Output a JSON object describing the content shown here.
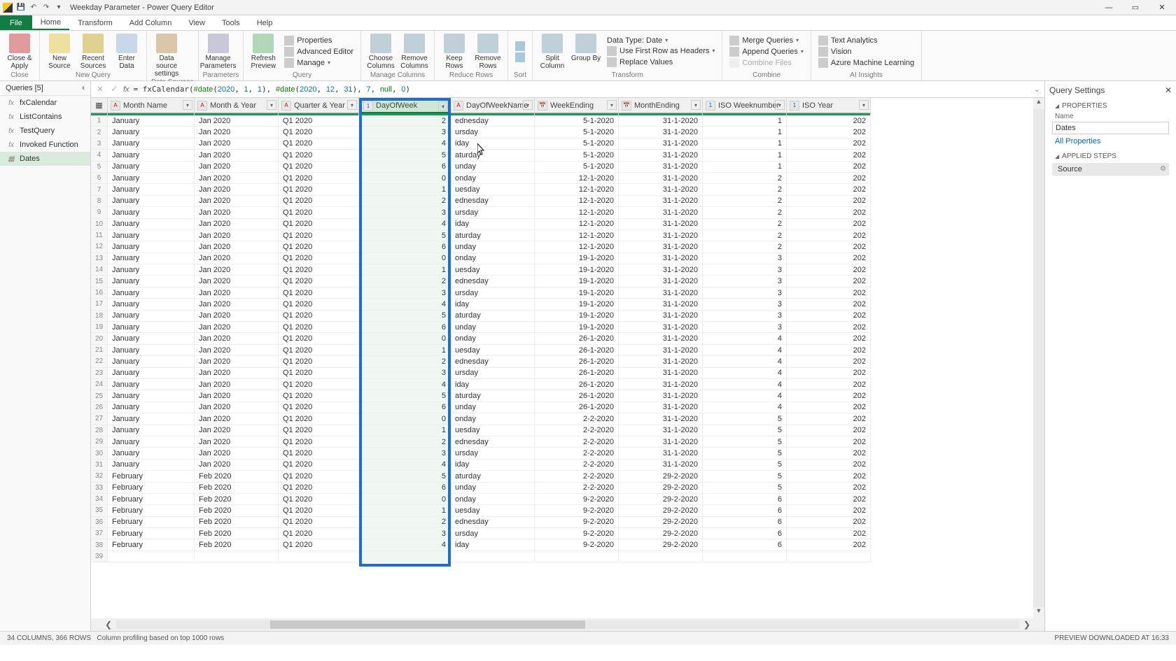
{
  "titlebar": {
    "title": "Weekday Parameter - Power Query Editor"
  },
  "menubar": {
    "file": "File",
    "tabs": [
      "Home",
      "Transform",
      "Add Column",
      "View",
      "Tools",
      "Help"
    ]
  },
  "ribbon": {
    "close_apply": "Close &\nApply",
    "close_group": "Close",
    "new_source": "New\nSource",
    "recent_sources": "Recent\nSources",
    "enter_data": "Enter\nData",
    "new_query_group": "New Query",
    "data_source_settings": "Data source\nsettings",
    "data_sources_group": "Data Sources",
    "manage_parameters": "Manage\nParameters",
    "parameters_group": "Parameters",
    "refresh_preview": "Refresh\nPreview",
    "properties": "Properties",
    "advanced_editor": "Advanced Editor",
    "manage": "Manage",
    "query_group": "Query",
    "choose_columns": "Choose\nColumns",
    "remove_columns": "Remove\nColumns",
    "manage_columns_group": "Manage Columns",
    "keep_rows": "Keep\nRows",
    "remove_rows": "Remove\nRows",
    "reduce_rows_group": "Reduce Rows",
    "sort_group": "Sort",
    "split_column": "Split\nColumn",
    "group_by": "Group\nBy",
    "data_type": "Data Type: Date",
    "use_first_row": "Use First Row as Headers",
    "replace_values": "Replace Values",
    "transform_group": "Transform",
    "merge_queries": "Merge Queries",
    "append_queries": "Append Queries",
    "combine_files": "Combine Files",
    "combine_group": "Combine",
    "text_analytics": "Text Analytics",
    "vision": "Vision",
    "azure_ml": "Azure Machine Learning",
    "ai_group": "AI Insights"
  },
  "queries": {
    "header": "Queries [5]",
    "items": [
      {
        "icon": "fx",
        "name": "fxCalendar"
      },
      {
        "icon": "fx",
        "name": "ListContains"
      },
      {
        "icon": "fx",
        "name": "TestQuery"
      },
      {
        "icon": "fx",
        "name": "Invoked Function"
      },
      {
        "icon": "tbl",
        "name": "Dates"
      }
    ]
  },
  "formula": "= fxCalendar(#date(2020, 1, 1), #date(2020, 12, 31), 7, null, 0)",
  "columns": [
    {
      "type": "txt",
      "name": "Month Name"
    },
    {
      "type": "txt",
      "name": "Month & Year"
    },
    {
      "type": "txt",
      "name": "Quarter & Year"
    },
    {
      "type": "num",
      "name": "DayOfWeek",
      "selected": true
    },
    {
      "type": "txt",
      "name": "DayOfWeekName"
    },
    {
      "type": "date",
      "name": "WeekEnding"
    },
    {
      "type": "date",
      "name": "MonthEnding"
    },
    {
      "type": "num",
      "name": "ISO Weeknumber"
    },
    {
      "type": "num",
      "name": "ISO Year"
    }
  ],
  "rows": [
    [
      "January",
      "Jan 2020",
      "Q1 2020",
      "2",
      "ednesday",
      "5-1-2020",
      "31-1-2020",
      "1",
      "202"
    ],
    [
      "January",
      "Jan 2020",
      "Q1 2020",
      "3",
      "ursday",
      "5-1-2020",
      "31-1-2020",
      "1",
      "202"
    ],
    [
      "January",
      "Jan 2020",
      "Q1 2020",
      "4",
      "iday",
      "5-1-2020",
      "31-1-2020",
      "1",
      "202"
    ],
    [
      "January",
      "Jan 2020",
      "Q1 2020",
      "5",
      "aturday",
      "5-1-2020",
      "31-1-2020",
      "1",
      "202"
    ],
    [
      "January",
      "Jan 2020",
      "Q1 2020",
      "6",
      "unday",
      "5-1-2020",
      "31-1-2020",
      "1",
      "202"
    ],
    [
      "January",
      "Jan 2020",
      "Q1 2020",
      "0",
      "onday",
      "12-1-2020",
      "31-1-2020",
      "2",
      "202"
    ],
    [
      "January",
      "Jan 2020",
      "Q1 2020",
      "1",
      "uesday",
      "12-1-2020",
      "31-1-2020",
      "2",
      "202"
    ],
    [
      "January",
      "Jan 2020",
      "Q1 2020",
      "2",
      "ednesday",
      "12-1-2020",
      "31-1-2020",
      "2",
      "202"
    ],
    [
      "January",
      "Jan 2020",
      "Q1 2020",
      "3",
      "ursday",
      "12-1-2020",
      "31-1-2020",
      "2",
      "202"
    ],
    [
      "January",
      "Jan 2020",
      "Q1 2020",
      "4",
      "iday",
      "12-1-2020",
      "31-1-2020",
      "2",
      "202"
    ],
    [
      "January",
      "Jan 2020",
      "Q1 2020",
      "5",
      "aturday",
      "12-1-2020",
      "31-1-2020",
      "2",
      "202"
    ],
    [
      "January",
      "Jan 2020",
      "Q1 2020",
      "6",
      "unday",
      "12-1-2020",
      "31-1-2020",
      "2",
      "202"
    ],
    [
      "January",
      "Jan 2020",
      "Q1 2020",
      "0",
      "onday",
      "19-1-2020",
      "31-1-2020",
      "3",
      "202"
    ],
    [
      "January",
      "Jan 2020",
      "Q1 2020",
      "1",
      "uesday",
      "19-1-2020",
      "31-1-2020",
      "3",
      "202"
    ],
    [
      "January",
      "Jan 2020",
      "Q1 2020",
      "2",
      "ednesday",
      "19-1-2020",
      "31-1-2020",
      "3",
      "202"
    ],
    [
      "January",
      "Jan 2020",
      "Q1 2020",
      "3",
      "ursday",
      "19-1-2020",
      "31-1-2020",
      "3",
      "202"
    ],
    [
      "January",
      "Jan 2020",
      "Q1 2020",
      "4",
      "iday",
      "19-1-2020",
      "31-1-2020",
      "3",
      "202"
    ],
    [
      "January",
      "Jan 2020",
      "Q1 2020",
      "5",
      "aturday",
      "19-1-2020",
      "31-1-2020",
      "3",
      "202"
    ],
    [
      "January",
      "Jan 2020",
      "Q1 2020",
      "6",
      "unday",
      "19-1-2020",
      "31-1-2020",
      "3",
      "202"
    ],
    [
      "January",
      "Jan 2020",
      "Q1 2020",
      "0",
      "onday",
      "26-1-2020",
      "31-1-2020",
      "4",
      "202"
    ],
    [
      "January",
      "Jan 2020",
      "Q1 2020",
      "1",
      "uesday",
      "26-1-2020",
      "31-1-2020",
      "4",
      "202"
    ],
    [
      "January",
      "Jan 2020",
      "Q1 2020",
      "2",
      "ednesday",
      "26-1-2020",
      "31-1-2020",
      "4",
      "202"
    ],
    [
      "January",
      "Jan 2020",
      "Q1 2020",
      "3",
      "ursday",
      "26-1-2020",
      "31-1-2020",
      "4",
      "202"
    ],
    [
      "January",
      "Jan 2020",
      "Q1 2020",
      "4",
      "iday",
      "26-1-2020",
      "31-1-2020",
      "4",
      "202"
    ],
    [
      "January",
      "Jan 2020",
      "Q1 2020",
      "5",
      "aturday",
      "26-1-2020",
      "31-1-2020",
      "4",
      "202"
    ],
    [
      "January",
      "Jan 2020",
      "Q1 2020",
      "6",
      "unday",
      "26-1-2020",
      "31-1-2020",
      "4",
      "202"
    ],
    [
      "January",
      "Jan 2020",
      "Q1 2020",
      "0",
      "onday",
      "2-2-2020",
      "31-1-2020",
      "5",
      "202"
    ],
    [
      "January",
      "Jan 2020",
      "Q1 2020",
      "1",
      "uesday",
      "2-2-2020",
      "31-1-2020",
      "5",
      "202"
    ],
    [
      "January",
      "Jan 2020",
      "Q1 2020",
      "2",
      "ednesday",
      "2-2-2020",
      "31-1-2020",
      "5",
      "202"
    ],
    [
      "January",
      "Jan 2020",
      "Q1 2020",
      "3",
      "ursday",
      "2-2-2020",
      "31-1-2020",
      "5",
      "202"
    ],
    [
      "January",
      "Jan 2020",
      "Q1 2020",
      "4",
      "iday",
      "2-2-2020",
      "31-1-2020",
      "5",
      "202"
    ],
    [
      "February",
      "Feb 2020",
      "Q1 2020",
      "5",
      "aturday",
      "2-2-2020",
      "29-2-2020",
      "5",
      "202"
    ],
    [
      "February",
      "Feb 2020",
      "Q1 2020",
      "6",
      "unday",
      "2-2-2020",
      "29-2-2020",
      "5",
      "202"
    ],
    [
      "February",
      "Feb 2020",
      "Q1 2020",
      "0",
      "onday",
      "9-2-2020",
      "29-2-2020",
      "6",
      "202"
    ],
    [
      "February",
      "Feb 2020",
      "Q1 2020",
      "1",
      "uesday",
      "9-2-2020",
      "29-2-2020",
      "6",
      "202"
    ],
    [
      "February",
      "Feb 2020",
      "Q1 2020",
      "2",
      "ednesday",
      "9-2-2020",
      "29-2-2020",
      "6",
      "202"
    ],
    [
      "February",
      "Feb 2020",
      "Q1 2020",
      "3",
      "ursday",
      "9-2-2020",
      "29-2-2020",
      "6",
      "202"
    ],
    [
      "February",
      "Feb 2020",
      "Q1 2020",
      "4",
      "iday",
      "9-2-2020",
      "29-2-2020",
      "6",
      "202"
    ]
  ],
  "last_row_num": "39",
  "settings": {
    "header": "Query Settings",
    "properties_label": "PROPERTIES",
    "name_label": "Name",
    "name_value": "Dates",
    "all_properties": "All Properties",
    "applied_steps_label": "APPLIED STEPS",
    "step_source": "Source"
  },
  "status": {
    "left": "34 COLUMNS, 366 ROWS",
    "mid": "Column profiling based on top 1000 rows",
    "right": "PREVIEW DOWNLOADED AT 16:33"
  }
}
